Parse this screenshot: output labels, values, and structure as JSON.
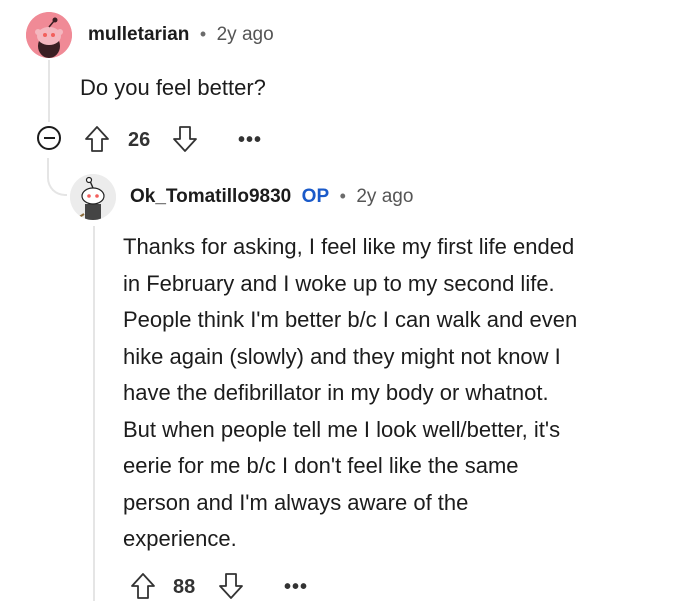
{
  "comments": [
    {
      "username": "mulletarian",
      "time": "2y ago",
      "body": "Do you feel better?",
      "votes": "26",
      "avatar_color": "#f08a96"
    },
    {
      "username": "Ok_Tomatillo9830",
      "op_badge": "OP",
      "time": "2y ago",
      "body_lines": [
        "Thanks for asking, I feel like my first life ended",
        "in February and I woke up to my second life.",
        "People think I'm better b/c I can walk and even",
        "hike again (slowly) and they might not know I",
        "have the defibrillator in my body or whatnot.",
        "But when people tell me I look well/better, it's",
        "eerie for me b/c I don't feel like the same",
        "person and I'm always aware of the",
        "experience."
      ],
      "votes": "88"
    }
  ],
  "separator": "•",
  "more_label": "•••",
  "colors": {
    "op": "#1a5ac9",
    "thread": "#e5e5e5"
  },
  "icons": [
    "upvote-icon",
    "downvote-icon",
    "collapse-icon",
    "more-options-icon"
  ]
}
